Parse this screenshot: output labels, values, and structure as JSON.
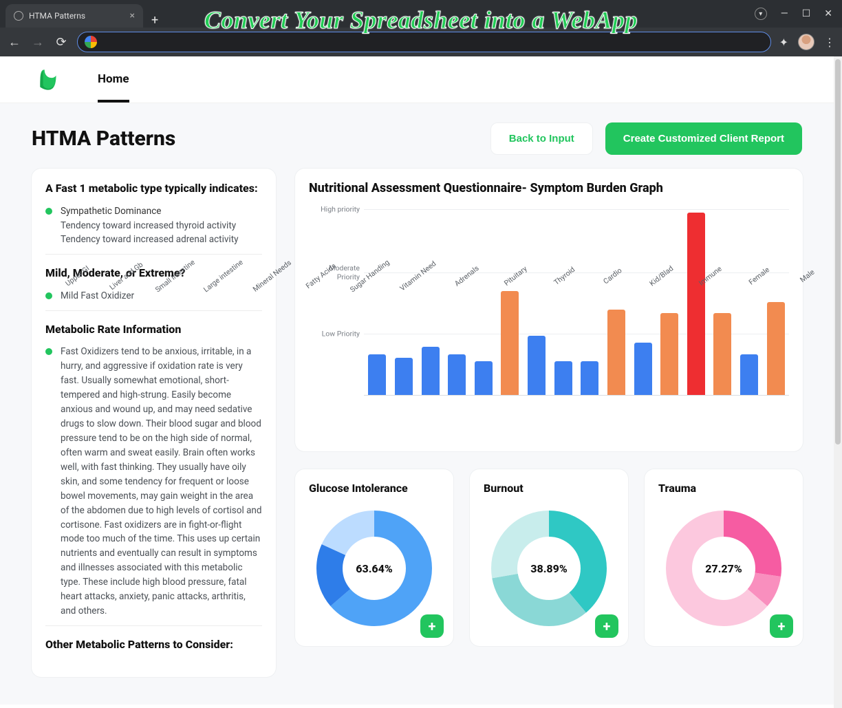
{
  "browser": {
    "tab_title": "HTMA Patterns",
    "overlay_headline": "Convert Your Spreadsheet into a WebApp"
  },
  "header": {
    "nav_home": "Home"
  },
  "page": {
    "title": "HTMA Patterns",
    "actions": {
      "back_label": "Back to Input",
      "report_label": "Create Customized Client Report"
    }
  },
  "sidebar": {
    "section1": {
      "heading": "A Fast 1 metabolic type typically indicates:",
      "lines": [
        "Sympathetic Dominance",
        "Tendency toward increased thyroid activity",
        "Tendency toward increased adrenal activity"
      ]
    },
    "section2": {
      "heading": "Mild, Moderate, or Extreme?",
      "item": "Mild Fast Oxidizer"
    },
    "section3": {
      "heading": "Metabolic Rate Information",
      "body": "Fast Oxidizers tend to be anxious, irritable, in a hurry, and aggressive if oxidation rate is very fast. Usually somewhat emotional, short-tempered and high-strung. Easily become anxious and wound up, and may need sedative drugs to slow down. Their blood sugar and blood pressure tend to be on the high side of normal, often warm and sweat easily. Brain often works well, with fast thinking. They usually have oily skin, and some tendency for frequent or loose bowel movements, may gain weight in the area of the abdomen due to high levels of cortisol and cortisone. Fast oxidizers are in fight-or-flight mode too much of the time. This uses up certain nutrients and eventually can result in symptoms and illnesses associated with this metabolic type. These include high blood pressure, fatal heart attacks, anxiety, panic attacks, arthritis, and others."
    },
    "section4": {
      "heading": "Other Metabolic Patterns to Consider:"
    }
  },
  "chart_data": {
    "type": "bar",
    "title": "Nutritional Assessment Questionnaire- Symptom Burden Graph",
    "y_ticks": [
      "Low Priority",
      "Moderate Priority",
      "High priority"
    ],
    "ylim": [
      0,
      100
    ],
    "categories": [
      "Upper GI",
      "Liver and Gb",
      "Small Intestine",
      "Large intestine",
      "Mineral Needs",
      "Fatty Acids",
      "Sugar Handing",
      "Vitamin Need",
      "Adrenals",
      "Pituitary",
      "Thyroid",
      "Cardio",
      "Kid/Blad",
      "Immune",
      "Female",
      "Male"
    ],
    "values": [
      22,
      20,
      26,
      22,
      18,
      56,
      32,
      18,
      18,
      46,
      28,
      44,
      98,
      44,
      22,
      50
    ],
    "colors": [
      "blue",
      "blue",
      "blue",
      "blue",
      "blue",
      "orange",
      "blue",
      "blue",
      "blue",
      "orange",
      "blue",
      "orange",
      "red",
      "orange",
      "blue",
      "orange"
    ],
    "palette": {
      "blue": "#3d7ff0",
      "orange": "#f28b50",
      "red": "#ee2e31"
    }
  },
  "donuts": [
    {
      "title": "Glucose Intolerance",
      "center_label": "63.64%",
      "segments": [
        {
          "pct": 63.64,
          "color": "#4fa3f7"
        },
        {
          "pct": 18.18,
          "color": "#2e7de9"
        },
        {
          "pct": 18.18,
          "color": "#bcdcff"
        }
      ]
    },
    {
      "title": "Burnout",
      "center_label": "38.89%",
      "segments": [
        {
          "pct": 38.89,
          "color": "#2fc8c4"
        },
        {
          "pct": 33.33,
          "color": "#8ad8d6"
        },
        {
          "pct": 27.78,
          "color": "#c8edec"
        }
      ]
    },
    {
      "title": "Trauma",
      "center_label": "27.27%",
      "segments": [
        {
          "pct": 27.27,
          "color": "#f65ca2"
        },
        {
          "pct": 9.09,
          "color": "#f98fbe"
        },
        {
          "pct": 63.64,
          "color": "#fcc8de"
        }
      ]
    }
  ]
}
